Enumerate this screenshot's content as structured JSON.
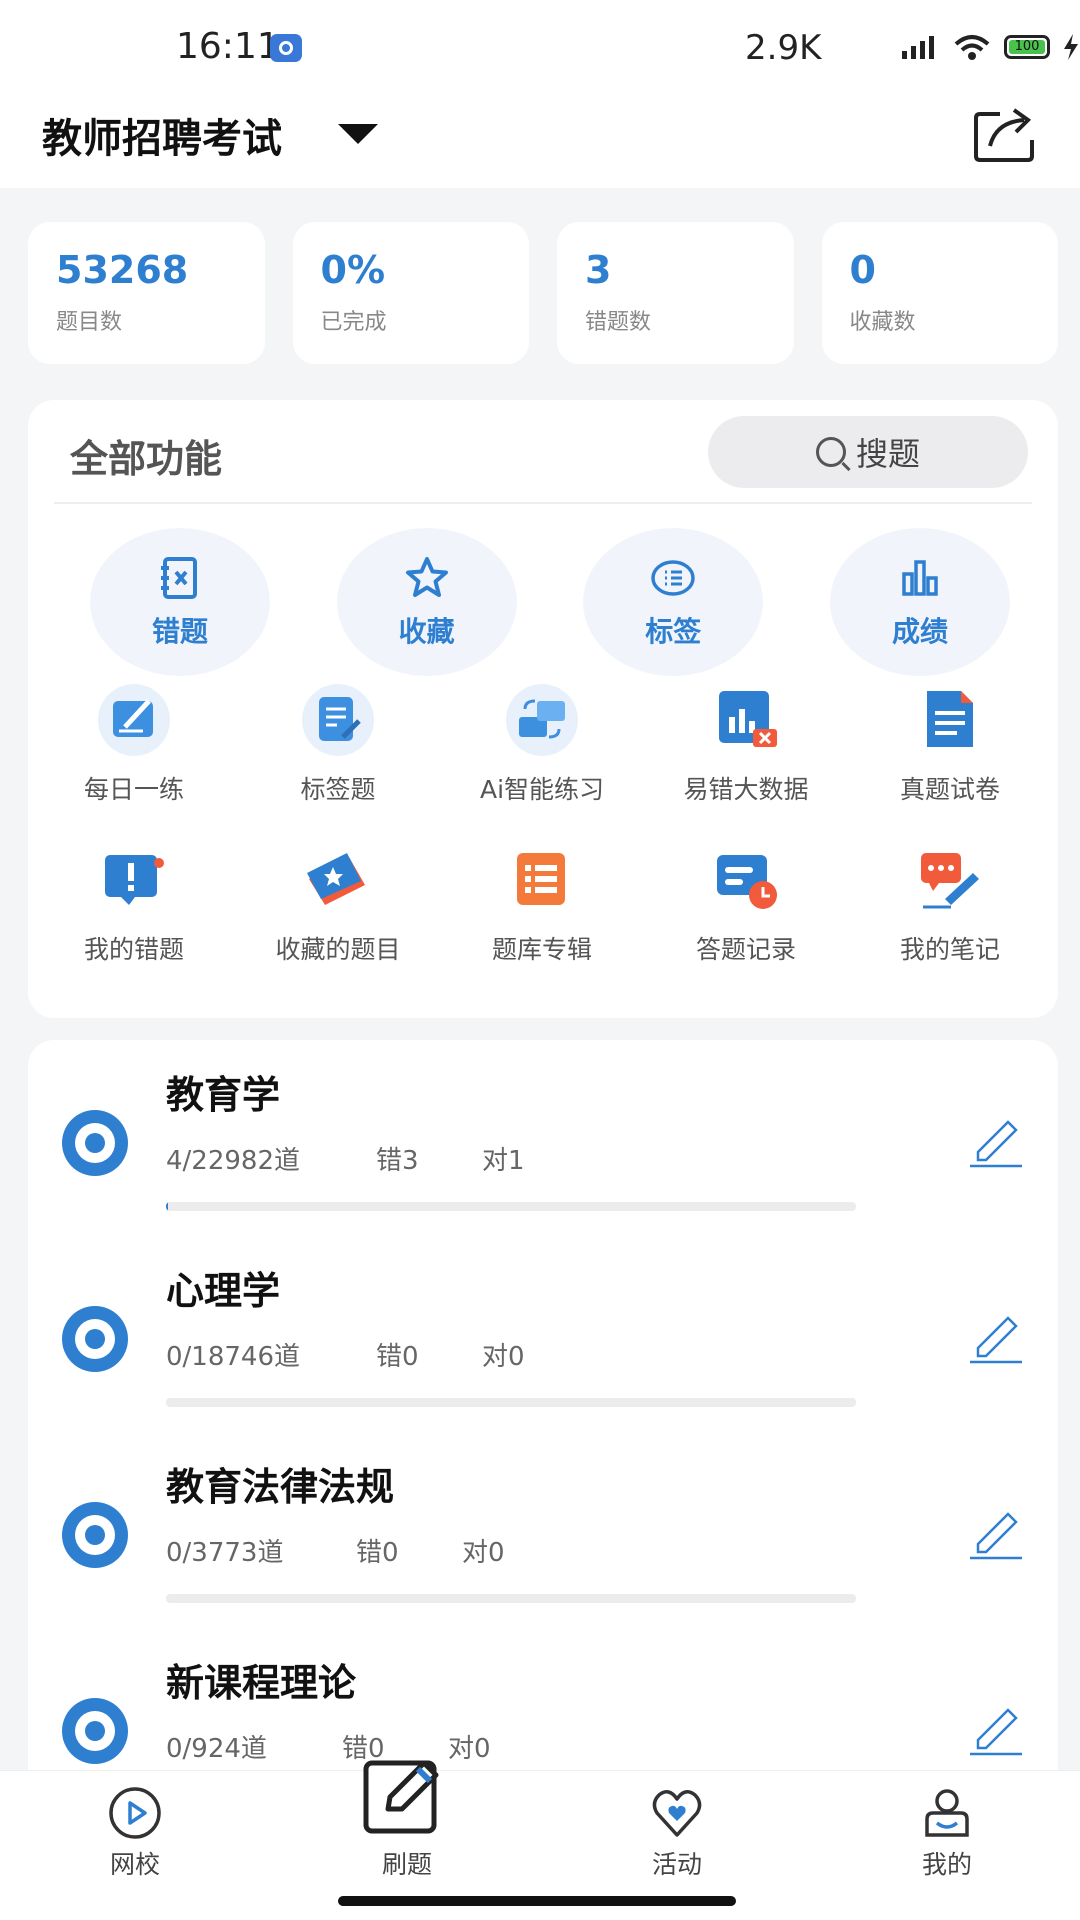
{
  "status_bar": {
    "time": "16:11",
    "network_speed": "2.9K",
    "battery": "100"
  },
  "header": {
    "exam_name": "教师招聘考试"
  },
  "stats": [
    {
      "value": "53268",
      "label": "题目数"
    },
    {
      "value": "0%",
      "label": "已完成"
    },
    {
      "value": "3",
      "label": "错题数"
    },
    {
      "value": "0",
      "label": "收藏数"
    }
  ],
  "functions": {
    "title": "全部功能",
    "search_label": "搜题",
    "primary": [
      {
        "label": "错题",
        "icon": "notebook-icon"
      },
      {
        "label": "收藏",
        "icon": "star-icon"
      },
      {
        "label": "标签",
        "icon": "list-icon"
      },
      {
        "label": "成绩",
        "icon": "bar-chart-icon"
      }
    ],
    "row1": [
      {
        "label": "每日一练",
        "icon": "daily-practice-icon"
      },
      {
        "label": "标签题",
        "icon": "tag-question-icon"
      },
      {
        "label": "Ai智能练习",
        "icon": "ai-practice-icon"
      },
      {
        "label": "易错大数据",
        "icon": "error-data-icon"
      },
      {
        "label": "真题试卷",
        "icon": "exam-paper-icon"
      }
    ],
    "row2": [
      {
        "label": "我的错题",
        "icon": "my-mistakes-icon"
      },
      {
        "label": "收藏的题目",
        "icon": "favorites-ticket-icon"
      },
      {
        "label": "题库专辑",
        "icon": "question-bank-icon"
      },
      {
        "label": "答题记录",
        "icon": "answer-record-icon"
      },
      {
        "label": "我的笔记",
        "icon": "notes-icon"
      }
    ]
  },
  "courses": [
    {
      "name": "教育学",
      "count": "4/22982道",
      "wrong": "错3",
      "right": "对1",
      "progress": 0.0002
    },
    {
      "name": "心理学",
      "count": "0/18746道",
      "wrong": "错0",
      "right": "对0",
      "progress": 0
    },
    {
      "name": "教育法律法规",
      "count": "0/3773道",
      "wrong": "错0",
      "right": "对0",
      "progress": 0
    },
    {
      "name": "新课程理论",
      "count": "0/924道",
      "wrong": "错0",
      "right": "对0",
      "progress": 0
    }
  ],
  "tabs": [
    {
      "label": "网校",
      "icon": "play-circle-icon"
    },
    {
      "label": "刷题",
      "icon": "edit-square-icon"
    },
    {
      "label": "活动",
      "icon": "heart-chat-icon"
    },
    {
      "label": "我的",
      "icon": "user-icon"
    }
  ],
  "colors": {
    "accent": "#2f7fd1",
    "background": "#f4f5f7"
  }
}
